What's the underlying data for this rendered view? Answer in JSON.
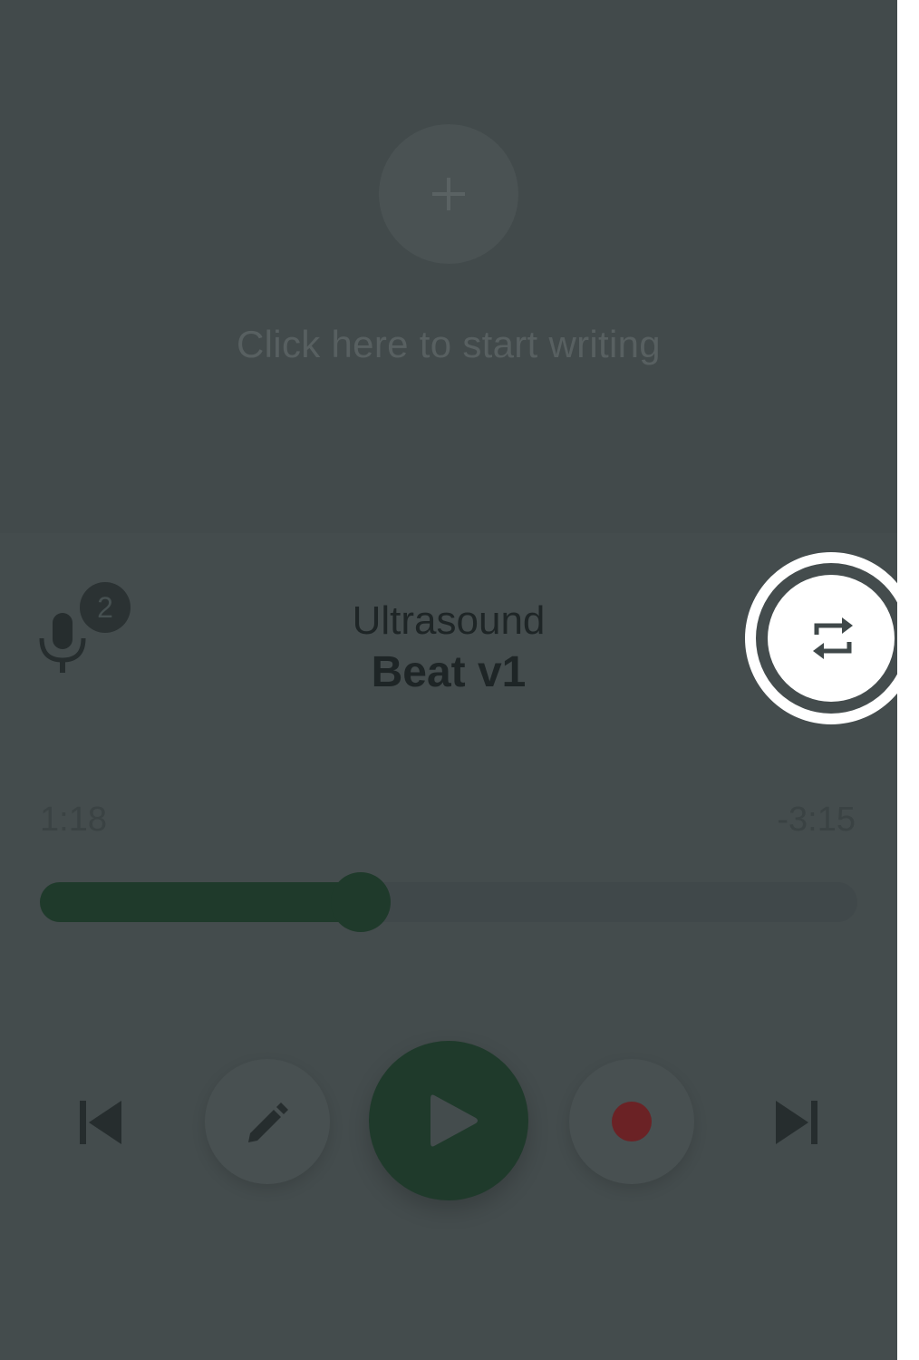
{
  "editor": {
    "add_icon": "plus-icon",
    "hint": "Click here to start writing"
  },
  "player": {
    "mic_icon": "microphone-icon",
    "take_count": "2",
    "title": "Ultrasound",
    "subtitle": "Beat v1",
    "repeat_icon": "repeat-icon",
    "time_elapsed": "1:18",
    "time_remaining": "-3:15",
    "progress": 0.393,
    "controls": {
      "previous_icon": "skip-previous-icon",
      "edit_icon": "pencil-icon",
      "play_icon": "play-icon",
      "record_icon": "record-icon",
      "next_icon": "skip-next-icon"
    }
  },
  "colors": {
    "overlay_bg": "#444c4d",
    "accent_green": "#1f3a2b",
    "record_red": "#6b2225",
    "highlight": "#ffffff"
  }
}
